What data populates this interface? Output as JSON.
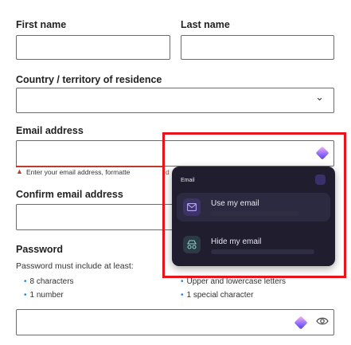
{
  "form": {
    "first_name_label": "First name",
    "last_name_label": "Last name",
    "country_label": "Country / territory of residence",
    "email_label": "Email address",
    "email_error": "Enter your email address, formatte",
    "email_error_tail": "d",
    "confirm_email_label": "Confirm email address",
    "password_label": "Password",
    "password_hint": "Password must include at least:",
    "requirements_left": [
      "8 characters",
      "1 number"
    ],
    "requirements_right": [
      "Upper and lowercase letters",
      "1 special character"
    ],
    "country_chevron": "⌄"
  },
  "popup": {
    "title": "Email",
    "items": [
      {
        "label": "Use my email",
        "icon": "envelope-icon"
      },
      {
        "label": "Hide my email",
        "icon": "incognito-icon"
      }
    ]
  },
  "colors": {
    "accent": "#6d4aff",
    "error": "#c0392b",
    "highlight": "#e8141c",
    "popup_bg": "#1f1d2e"
  }
}
